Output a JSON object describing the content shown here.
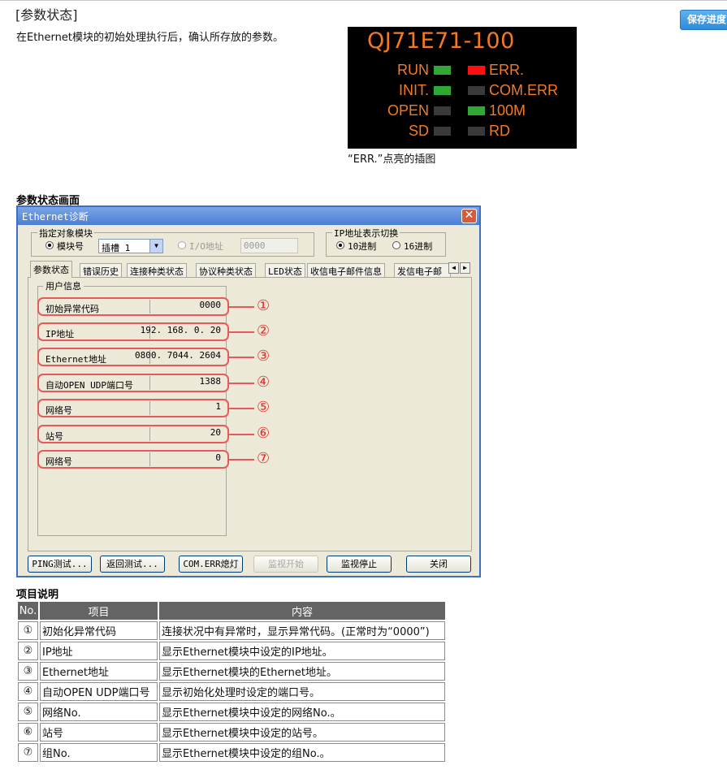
{
  "header": {
    "section_title": "[参数状态]",
    "save_button": "保存进度",
    "intro": "在Ethernet模块的初始处理执行后，确认所存放的参数。"
  },
  "led_panel": {
    "model": "QJ71E71-100",
    "caption": "“ERR.”点亮的插图",
    "leds": [
      {
        "label": "RUN",
        "color": "#2fa836"
      },
      {
        "label": "ERR.",
        "color": "#ff1010"
      },
      {
        "label": "INIT.",
        "color": "#2fa836"
      },
      {
        "label": "COM.ERR",
        "color": "#3a3a3a"
      },
      {
        "label": "OPEN",
        "color": "#3a3a3a"
      },
      {
        "label": "100M",
        "color": "#2fa836"
      },
      {
        "label": "SD",
        "color": "#3a3a3a"
      },
      {
        "label": "RD",
        "color": "#3a3a3a"
      }
    ]
  },
  "screen_heading": "参数状态画面",
  "dialog": {
    "title": "Ethernet诊断",
    "target_group": {
      "legend": "指定对象模块",
      "module_no_label": "模块号",
      "slot_value": "插槽 1",
      "io_addr_label": "I/O地址",
      "io_addr_value": "0000"
    },
    "ip_group": {
      "legend": "IP地址表示切换",
      "decimal_label": "10进制",
      "hex_label": "16进制"
    },
    "tabs": [
      "参数状态",
      "错误历史",
      "连接种类状态",
      "协议种类状态",
      "LED状态",
      "收信电子邮件信息",
      "发信电子邮"
    ],
    "user_info_legend": "用户信息",
    "rows": [
      {
        "label": "初始异常代码",
        "value": "0000",
        "marker": "①"
      },
      {
        "label": "IP地址",
        "value": "192. 168. 0. 20",
        "marker": "②"
      },
      {
        "label": "Ethernet地址",
        "value": "0800. 7044. 2604",
        "marker": "③"
      },
      {
        "label": "自动OPEN UDP端口号",
        "value": "1388",
        "marker": "④"
      },
      {
        "label": "网络号",
        "value": "1",
        "marker": "⑤"
      },
      {
        "label": "站号",
        "value": "20",
        "marker": "⑥"
      },
      {
        "label": "网络号",
        "value": "0",
        "marker": "⑦"
      }
    ],
    "buttons": {
      "ping": "PING测试...",
      "loopback": "返回测试...",
      "com_err": "COM.ERR熄灯",
      "monitor_start": "监视开始",
      "monitor_stop": "监视停止",
      "close": "关闭"
    }
  },
  "description": {
    "heading": "项目说明",
    "headers": [
      "No.",
      "项目",
      "内容"
    ],
    "rows": [
      [
        "①",
        "初始化异常代码",
        "连接状况中有异常时，显示异常代码。(正常时为“0000”)"
      ],
      [
        "②",
        "IP地址",
        "显示Ethernet模块中设定的IP地址。"
      ],
      [
        "③",
        "Ethernet地址",
        "显示Ethernet模块的Ethernet地址。"
      ],
      [
        "④",
        "自动OPEN UDP端口号",
        "显示初始化处理时设定的端口号。"
      ],
      [
        "⑤",
        "网络No.",
        "显示Ethernet模块中设定的网络No.。"
      ],
      [
        "⑥",
        "站号",
        "显示Ethernet模块中设定的站号。"
      ],
      [
        "⑦",
        "组No.",
        "显示Ethernet模块中设定的组No.。"
      ]
    ]
  }
}
